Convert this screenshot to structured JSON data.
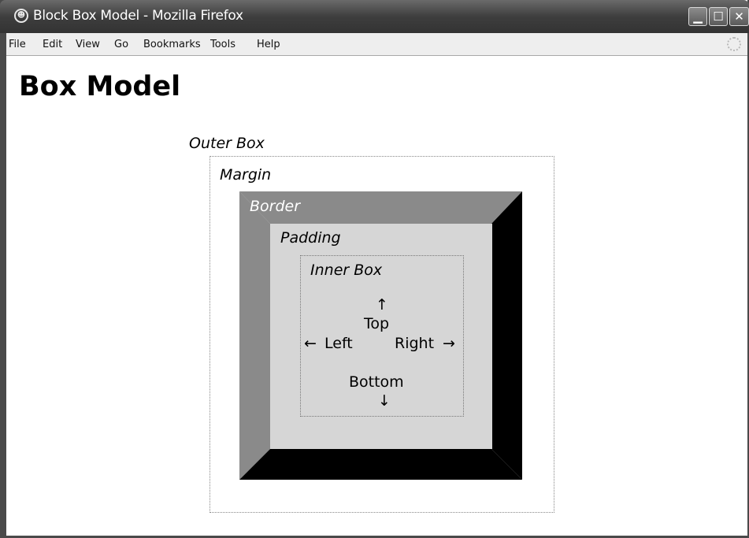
{
  "window": {
    "title": "Block Box Model - Mozilla Firefox",
    "controls": {
      "minimize_icon": "minimize-icon",
      "maximize_icon": "maximize-icon",
      "close_icon": "close-icon"
    }
  },
  "menubar": {
    "items": [
      "File",
      "Edit",
      "View",
      "Go",
      "Bookmarks",
      "Tools",
      "Help"
    ]
  },
  "page": {
    "heading": "Box Model",
    "diagram": {
      "outer_box": "Outer Box",
      "margin": "Margin",
      "border": "Border",
      "padding": "Padding",
      "inner_box": "Inner Box",
      "top": "Top",
      "left": "Left",
      "right": "Right",
      "bottom": "Bottom",
      "arrow_up": "↑",
      "arrow_down": "↓",
      "arrow_left": "←",
      "arrow_right": "→"
    }
  },
  "colors": {
    "titlebar": "#3e3e3e",
    "border_light": "#8a8a8a",
    "border_dark": "#000000",
    "padding": "#d6d6d6"
  }
}
